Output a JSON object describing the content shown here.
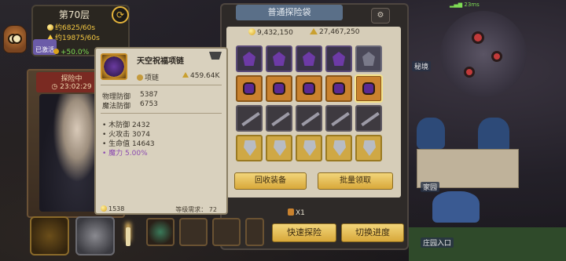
{
  "status": {
    "floor": "第70层",
    "gold_rate": "约6825/60s",
    "power_rate": "约19875/60s",
    "activated": "已激活",
    "bonus": "+50.0%"
  },
  "explore": {
    "label": "探险中",
    "timer": "23:02:29"
  },
  "tooltip": {
    "name": "天空祝福项链",
    "type": "项链",
    "power": "459.64K",
    "stats": [
      {
        "label": "物理防御",
        "value": "5387"
      },
      {
        "label": "魔法防御",
        "value": "6753"
      }
    ],
    "subs": [
      {
        "text": "• 木防御 2432",
        "purple": false
      },
      {
        "text": "• 火攻击 3074",
        "purple": false
      },
      {
        "text": "• 生命值 14643",
        "purple": false
      },
      {
        "text": "• 魔力 5.00%",
        "purple": true
      }
    ],
    "gold": "1538",
    "level_req": "等级需求：  72"
  },
  "bag": {
    "title": "普通探险袋",
    "gold": "9,432,150",
    "power": "27,467,250",
    "recycle_label": "回收装备",
    "collect_label": "批量领取",
    "potion": "X1",
    "quick_explore_label": "快速探险",
    "switch_progress_label": "切换进度",
    "rows": [
      [
        "helmet",
        "helmet",
        "helmet",
        "helmet",
        "helmet-plain"
      ],
      [
        "neck",
        "neck",
        "neck",
        "neck",
        "neck-selected"
      ],
      [
        "weapon",
        "weapon",
        "weapon",
        "weapon",
        "weapon"
      ],
      [
        "shield",
        "shield",
        "shield",
        "shield",
        "shield"
      ]
    ]
  },
  "world": {
    "secret_label": "秘境",
    "home_label": "家园",
    "entrance_label": "庄园入口",
    "net": "23ms"
  }
}
